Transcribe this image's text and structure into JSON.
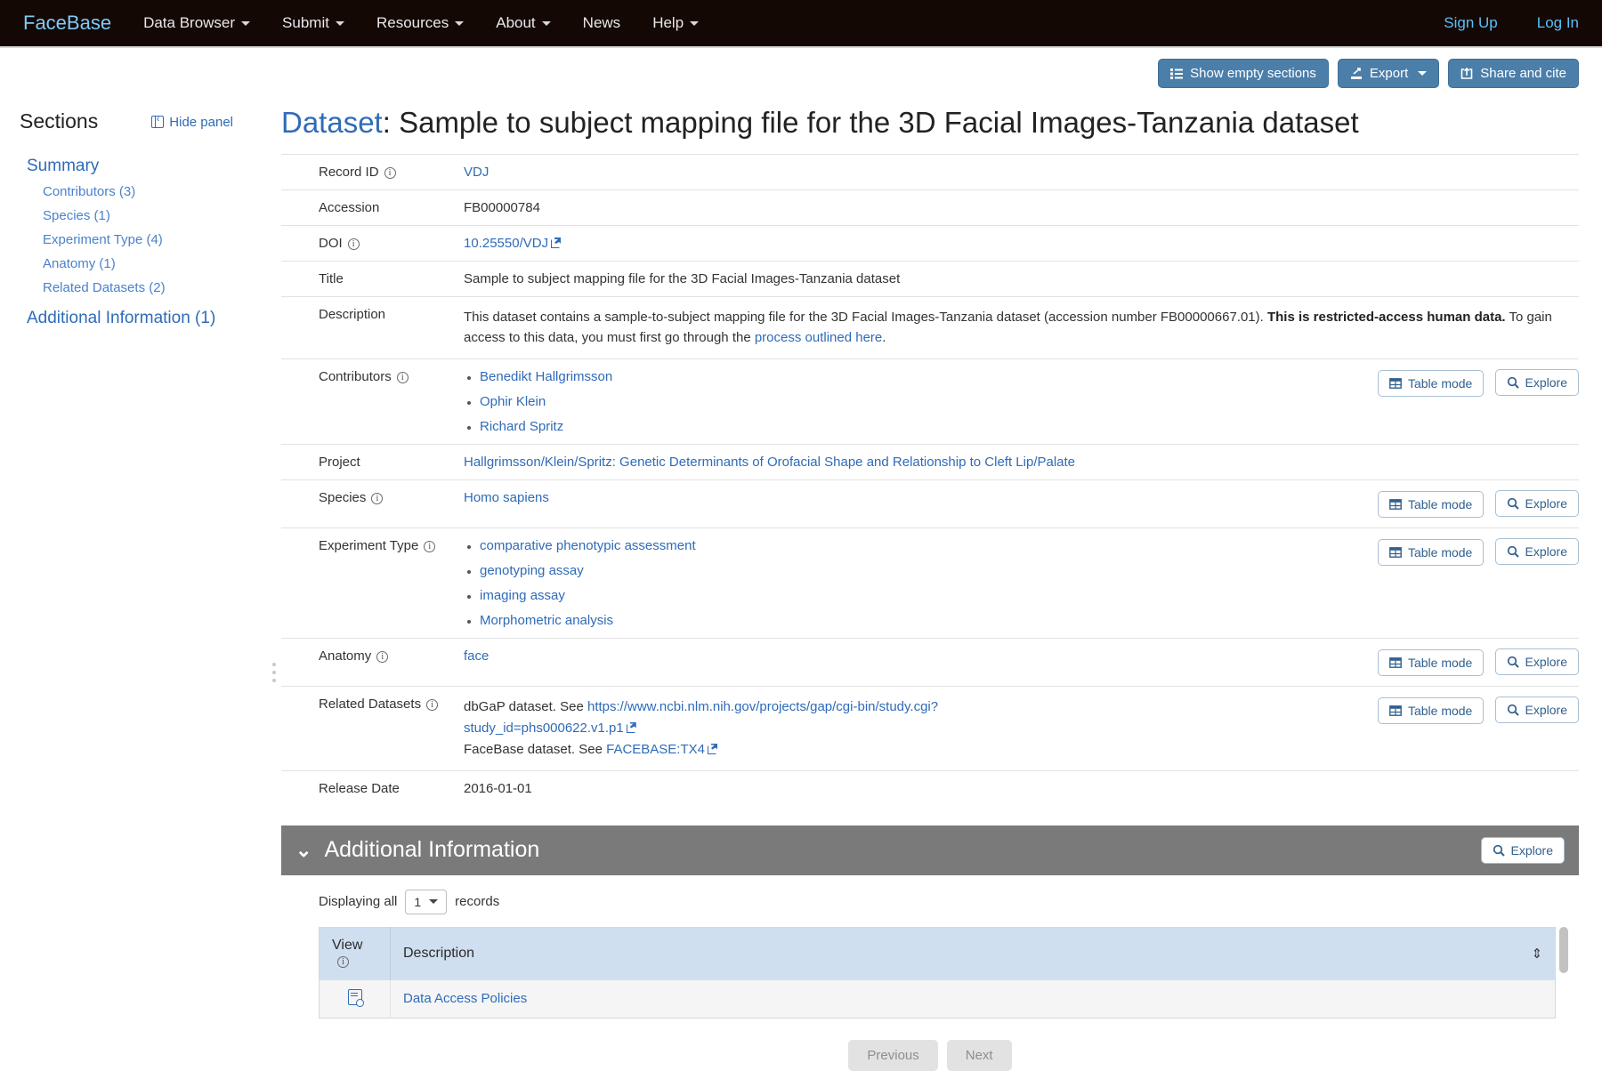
{
  "navbar": {
    "brand": "FaceBase",
    "items": [
      {
        "label": "Data Browser",
        "caret": true
      },
      {
        "label": "Submit",
        "caret": true
      },
      {
        "label": "Resources",
        "caret": true
      },
      {
        "label": "About",
        "caret": true
      },
      {
        "label": "News",
        "caret": false
      },
      {
        "label": "Help",
        "caret": true
      }
    ],
    "right": [
      {
        "label": "Sign Up"
      },
      {
        "label": "Log In"
      }
    ],
    "bg_color": "#140805",
    "brand_color": "#7ecbf5",
    "link_color": "#5bc0f8"
  },
  "actionbar": {
    "show_empty_sections": "Show empty sections",
    "export": "Export",
    "share_and_cite": "Share and cite",
    "button_color": "#4b7faa"
  },
  "sidebar": {
    "title": "Sections",
    "hide_panel": "Hide panel",
    "summary": "Summary",
    "sub_items": [
      {
        "label": "Contributors (3)"
      },
      {
        "label": "Species (1)"
      },
      {
        "label": "Experiment Type (4)"
      },
      {
        "label": "Anatomy (1)"
      },
      {
        "label": "Related Datasets (2)"
      }
    ],
    "additional_information": "Additional Information (1)"
  },
  "page": {
    "title_kind": "Dataset",
    "title_sep": ": ",
    "title_text": "Sample to subject mapping file for the 3D Facial Images-Tanzania dataset"
  },
  "buttons": {
    "table_mode": "Table mode",
    "explore": "Explore"
  },
  "record": {
    "record_id_label": "Record ID",
    "record_id_value": "VDJ",
    "accession_label": "Accession",
    "accession_value": "FB00000784",
    "doi_label": "DOI",
    "doi_value": "10.25550/VDJ",
    "title_label": "Title",
    "title_value": "Sample to subject mapping file for the 3D Facial Images-Tanzania dataset",
    "description_label": "Description",
    "description_part1": "This dataset contains a sample-to-subject mapping file for the 3D Facial Images-Tanzania dataset (accession number FB00000667.01). ",
    "description_bold": "This is restricted-access human data.",
    "description_part2": " To gain access to this data, you must first go through the ",
    "description_link": "process outlined here",
    "description_end": ".",
    "contributors_label": "Contributors",
    "contributors": [
      "Benedikt Hallgrimsson",
      "Ophir Klein",
      "Richard Spritz"
    ],
    "project_label": "Project",
    "project_value": "Hallgrimsson/Klein/Spritz: Genetic Determinants of Orofacial Shape and Relationship to Cleft Lip/Palate",
    "species_label": "Species",
    "species_value": "Homo sapiens",
    "experiment_type_label": "Experiment Type",
    "experiment_types": [
      "comparative phenotypic assessment",
      "genotyping assay",
      "imaging assay",
      "Morphometric analysis"
    ],
    "anatomy_label": "Anatomy",
    "anatomy_value": "face",
    "related_datasets_label": "Related Datasets",
    "related_dataset_1_prefix": "dbGaP dataset. See ",
    "related_dataset_1_link": "https://www.ncbi.nlm.nih.gov/projects/gap/cgi-bin/study.cgi?study_id=phs000622.v1.p1",
    "related_dataset_2_prefix": "FaceBase dataset. See ",
    "related_dataset_2_link": "FACEBASE:TX4",
    "release_date_label": "Release Date",
    "release_date_value": "2016-01-01"
  },
  "additional_information": {
    "heading": "Additional Information",
    "explore": "Explore",
    "displaying_prefix": "Displaying all",
    "page_size": "1",
    "displaying_suffix": "records",
    "columns": [
      "View",
      "Description"
    ],
    "rows": [
      {
        "view_icon": "view-record-icon",
        "description": "Data Access Policies"
      }
    ],
    "previous": "Previous",
    "next": "Next",
    "header_bg": "#7a7a7a",
    "table_header_bg": "#cfdff0"
  }
}
